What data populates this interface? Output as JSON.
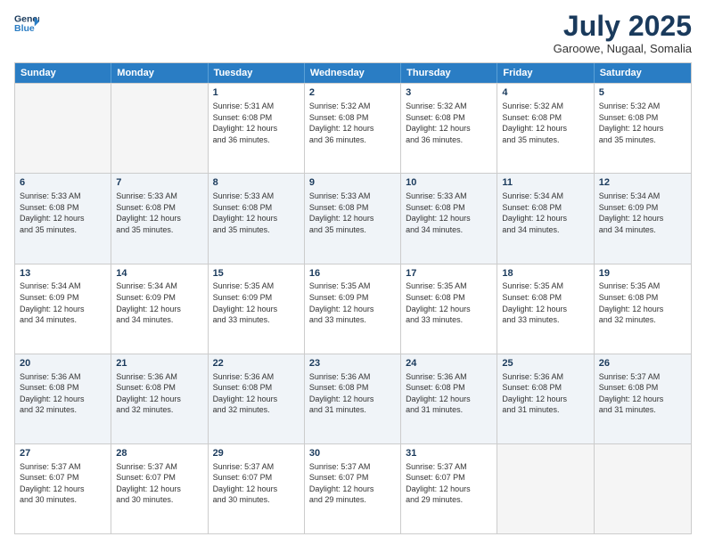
{
  "logo": {
    "line1": "General",
    "line2": "Blue"
  },
  "header": {
    "month": "July 2025",
    "location": "Garoowe, Nugaal, Somalia"
  },
  "weekdays": [
    "Sunday",
    "Monday",
    "Tuesday",
    "Wednesday",
    "Thursday",
    "Friday",
    "Saturday"
  ],
  "rows": [
    [
      {
        "day": "",
        "info": "",
        "empty": true
      },
      {
        "day": "",
        "info": "",
        "empty": true
      },
      {
        "day": "1",
        "info": "Sunrise: 5:31 AM\nSunset: 6:08 PM\nDaylight: 12 hours\nand 36 minutes."
      },
      {
        "day": "2",
        "info": "Sunrise: 5:32 AM\nSunset: 6:08 PM\nDaylight: 12 hours\nand 36 minutes."
      },
      {
        "day": "3",
        "info": "Sunrise: 5:32 AM\nSunset: 6:08 PM\nDaylight: 12 hours\nand 36 minutes."
      },
      {
        "day": "4",
        "info": "Sunrise: 5:32 AM\nSunset: 6:08 PM\nDaylight: 12 hours\nand 35 minutes."
      },
      {
        "day": "5",
        "info": "Sunrise: 5:32 AM\nSunset: 6:08 PM\nDaylight: 12 hours\nand 35 minutes."
      }
    ],
    [
      {
        "day": "6",
        "info": "Sunrise: 5:33 AM\nSunset: 6:08 PM\nDaylight: 12 hours\nand 35 minutes."
      },
      {
        "day": "7",
        "info": "Sunrise: 5:33 AM\nSunset: 6:08 PM\nDaylight: 12 hours\nand 35 minutes."
      },
      {
        "day": "8",
        "info": "Sunrise: 5:33 AM\nSunset: 6:08 PM\nDaylight: 12 hours\nand 35 minutes."
      },
      {
        "day": "9",
        "info": "Sunrise: 5:33 AM\nSunset: 6:08 PM\nDaylight: 12 hours\nand 35 minutes."
      },
      {
        "day": "10",
        "info": "Sunrise: 5:33 AM\nSunset: 6:08 PM\nDaylight: 12 hours\nand 34 minutes."
      },
      {
        "day": "11",
        "info": "Sunrise: 5:34 AM\nSunset: 6:08 PM\nDaylight: 12 hours\nand 34 minutes."
      },
      {
        "day": "12",
        "info": "Sunrise: 5:34 AM\nSunset: 6:09 PM\nDaylight: 12 hours\nand 34 minutes."
      }
    ],
    [
      {
        "day": "13",
        "info": "Sunrise: 5:34 AM\nSunset: 6:09 PM\nDaylight: 12 hours\nand 34 minutes."
      },
      {
        "day": "14",
        "info": "Sunrise: 5:34 AM\nSunset: 6:09 PM\nDaylight: 12 hours\nand 34 minutes."
      },
      {
        "day": "15",
        "info": "Sunrise: 5:35 AM\nSunset: 6:09 PM\nDaylight: 12 hours\nand 33 minutes."
      },
      {
        "day": "16",
        "info": "Sunrise: 5:35 AM\nSunset: 6:09 PM\nDaylight: 12 hours\nand 33 minutes."
      },
      {
        "day": "17",
        "info": "Sunrise: 5:35 AM\nSunset: 6:08 PM\nDaylight: 12 hours\nand 33 minutes."
      },
      {
        "day": "18",
        "info": "Sunrise: 5:35 AM\nSunset: 6:08 PM\nDaylight: 12 hours\nand 33 minutes."
      },
      {
        "day": "19",
        "info": "Sunrise: 5:35 AM\nSunset: 6:08 PM\nDaylight: 12 hours\nand 32 minutes."
      }
    ],
    [
      {
        "day": "20",
        "info": "Sunrise: 5:36 AM\nSunset: 6:08 PM\nDaylight: 12 hours\nand 32 minutes."
      },
      {
        "day": "21",
        "info": "Sunrise: 5:36 AM\nSunset: 6:08 PM\nDaylight: 12 hours\nand 32 minutes."
      },
      {
        "day": "22",
        "info": "Sunrise: 5:36 AM\nSunset: 6:08 PM\nDaylight: 12 hours\nand 32 minutes."
      },
      {
        "day": "23",
        "info": "Sunrise: 5:36 AM\nSunset: 6:08 PM\nDaylight: 12 hours\nand 31 minutes."
      },
      {
        "day": "24",
        "info": "Sunrise: 5:36 AM\nSunset: 6:08 PM\nDaylight: 12 hours\nand 31 minutes."
      },
      {
        "day": "25",
        "info": "Sunrise: 5:36 AM\nSunset: 6:08 PM\nDaylight: 12 hours\nand 31 minutes."
      },
      {
        "day": "26",
        "info": "Sunrise: 5:37 AM\nSunset: 6:08 PM\nDaylight: 12 hours\nand 31 minutes."
      }
    ],
    [
      {
        "day": "27",
        "info": "Sunrise: 5:37 AM\nSunset: 6:07 PM\nDaylight: 12 hours\nand 30 minutes."
      },
      {
        "day": "28",
        "info": "Sunrise: 5:37 AM\nSunset: 6:07 PM\nDaylight: 12 hours\nand 30 minutes."
      },
      {
        "day": "29",
        "info": "Sunrise: 5:37 AM\nSunset: 6:07 PM\nDaylight: 12 hours\nand 30 minutes."
      },
      {
        "day": "30",
        "info": "Sunrise: 5:37 AM\nSunset: 6:07 PM\nDaylight: 12 hours\nand 29 minutes."
      },
      {
        "day": "31",
        "info": "Sunrise: 5:37 AM\nSunset: 6:07 PM\nDaylight: 12 hours\nand 29 minutes."
      },
      {
        "day": "",
        "info": "",
        "empty": true
      },
      {
        "day": "",
        "info": "",
        "empty": true
      }
    ]
  ]
}
